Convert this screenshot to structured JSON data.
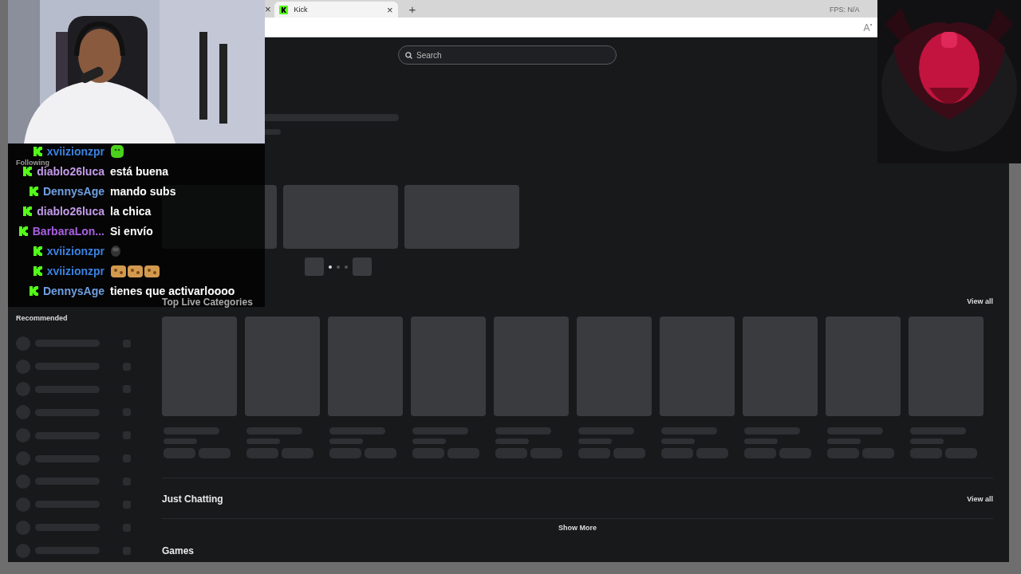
{
  "browser": {
    "tabs": [
      {
        "label": "Kick",
        "selected": true
      }
    ],
    "prev_tab_close": "×",
    "tab_close": "×",
    "new_tab": "+",
    "fps": "FPS: N/A"
  },
  "search": {
    "placeholder": "Search"
  },
  "sidebar": {
    "following_heading": "Following",
    "recommended_heading": "Recommended"
  },
  "sections": [
    {
      "title": "Top Live Categories",
      "link": "View all"
    },
    {
      "title": "Just Chatting",
      "link": "View all",
      "more": "Show More"
    },
    {
      "title": "Games"
    }
  ],
  "chat": [
    {
      "user": "xviizionzpr",
      "color": "#3b82e0",
      "kind": "sticker"
    },
    {
      "user": "diablo26luca",
      "color": "#c39be8",
      "kind": "text",
      "text": "está buena"
    },
    {
      "user": "DennysAge",
      "color": "#6fa0e0",
      "kind": "text",
      "text": "mando subs"
    },
    {
      "user": "diablo26luca",
      "color": "#c39be8",
      "kind": "text",
      "text": "la chica"
    },
    {
      "user": "BarbaraLon...",
      "color": "#a95fe0",
      "kind": "text",
      "text": "Si envío"
    },
    {
      "user": "xviizionzpr",
      "color": "#3b82e0",
      "kind": "badge"
    },
    {
      "user": "xviizionzpr",
      "color": "#3b82e0",
      "kind": "cookies"
    },
    {
      "user": "DennysAge",
      "color": "#6fa0e0",
      "kind": "text",
      "text": "tienes que activarloooo"
    }
  ]
}
